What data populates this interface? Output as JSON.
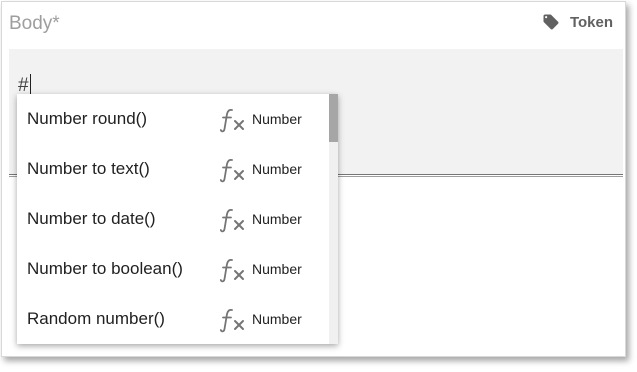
{
  "field": {
    "label": "Body*",
    "value": "#",
    "token_button_label": "Token",
    "token_icon": "tag-icon"
  },
  "dropdown": {
    "items": [
      {
        "label": "Number round()",
        "icon": "function-icon",
        "type": "Number"
      },
      {
        "label": "Number to text()",
        "icon": "function-icon",
        "type": "Number"
      },
      {
        "label": "Number to date()",
        "icon": "function-icon",
        "type": "Number"
      },
      {
        "label": "Number to boolean()",
        "icon": "function-icon",
        "type": "Number"
      },
      {
        "label": "Random number()",
        "icon": "function-icon",
        "type": "Number"
      }
    ]
  },
  "colors": {
    "editor_background": "#f2f2f2",
    "label_gray": "#9e9e9e",
    "scroll_thumb": "#a6a6a6"
  }
}
